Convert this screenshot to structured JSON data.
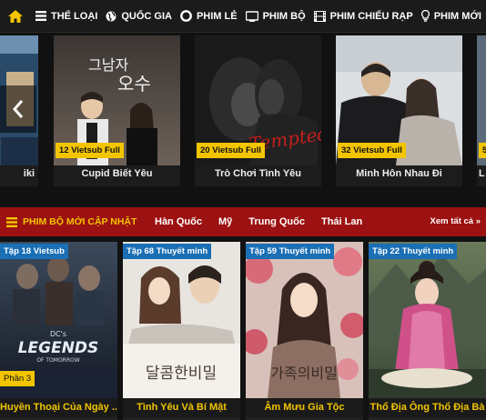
{
  "nav": {
    "home_icon": "home-icon",
    "items": [
      {
        "label": "THỂ LOẠI",
        "icon": "list-icon"
      },
      {
        "label": "QUỐC GIA",
        "icon": "globe-icon"
      },
      {
        "label": "PHIM LẺ",
        "icon": "lifebuoy-icon"
      },
      {
        "label": "PHIM BỘ",
        "icon": "tv-icon"
      },
      {
        "label": "PHIM CHIẾU RẠP",
        "icon": "film-icon"
      },
      {
        "label": "PHIM MỚI",
        "icon": "lightbulb-icon"
      }
    ]
  },
  "carousel": {
    "left_partial_title": "iki",
    "slides": [
      {
        "badge": "12 Vietsub Full",
        "title": "Cupid Biết Yêu"
      },
      {
        "badge": "20 Vietsub Full",
        "title": "Trò Chơi Tình Yêu"
      },
      {
        "badge": "32 Vietsub Full",
        "title": "Minh Hôn Nhau Đi"
      },
      {
        "badge": "5 V",
        "title": "L"
      }
    ]
  },
  "section": {
    "title": "PHIM BỘ MỚI CẬP NHẬT",
    "tabs": [
      "Hàn Quốc",
      "Mỹ",
      "Trung Quốc",
      "Thái Lan"
    ],
    "see_all": "Xem tất cả »"
  },
  "grid": [
    {
      "badge": "Tập 18 Vietsub",
      "part": "Phần 3",
      "title": "Huyền Thoại Của Ngày ...",
      "poster_text": "LEGENDS"
    },
    {
      "badge": "Tập 68 Thuyết minh",
      "part": "",
      "title": "Tình Yêu Và Bí Mật",
      "poster_text": "달콤한비밀"
    },
    {
      "badge": "Tập 59 Thuyết minh",
      "part": "",
      "title": "Âm Mưu Gia Tộc",
      "poster_text": "가족의비밀"
    },
    {
      "badge": "Tập 22 Thuyết minh",
      "part": "",
      "title": "Thổ Địa Ông Thổ Địa Bà",
      "poster_text": ""
    }
  ],
  "colors": {
    "accent_yellow": "#f2c500",
    "section_red": "#9c1111",
    "badge_blue": "#1a6fb5"
  }
}
